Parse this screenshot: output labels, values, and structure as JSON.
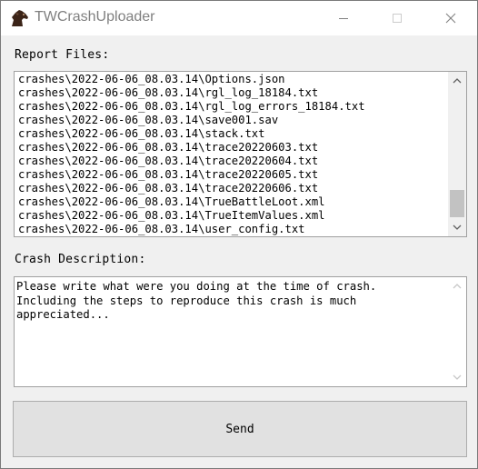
{
  "window": {
    "title": "TWCrashUploader",
    "icon": "horse-head-icon"
  },
  "report_files": {
    "label": "Report Files:",
    "items": [
      "crashes\\2022-06-06_08.03.14\\Options.json",
      "crashes\\2022-06-06_08.03.14\\rgl_log_18184.txt",
      "crashes\\2022-06-06_08.03.14\\rgl_log_errors_18184.txt",
      "crashes\\2022-06-06_08.03.14\\save001.sav",
      "crashes\\2022-06-06_08.03.14\\stack.txt",
      "crashes\\2022-06-06_08.03.14\\trace20220603.txt",
      "crashes\\2022-06-06_08.03.14\\trace20220604.txt",
      "crashes\\2022-06-06_08.03.14\\trace20220605.txt",
      "crashes\\2022-06-06_08.03.14\\trace20220606.txt",
      "crashes\\2022-06-06_08.03.14\\TrueBattleLoot.xml",
      "crashes\\2022-06-06_08.03.14\\TrueItemValues.xml",
      "crashes\\2022-06-06_08.03.14\\user_config.txt"
    ]
  },
  "crash_description": {
    "label": "Crash Description:",
    "value": "Please write what were you doing at the time of crash.\nIncluding the steps to reproduce this crash is much\nappreciated..."
  },
  "send_button": {
    "label": "Send"
  }
}
